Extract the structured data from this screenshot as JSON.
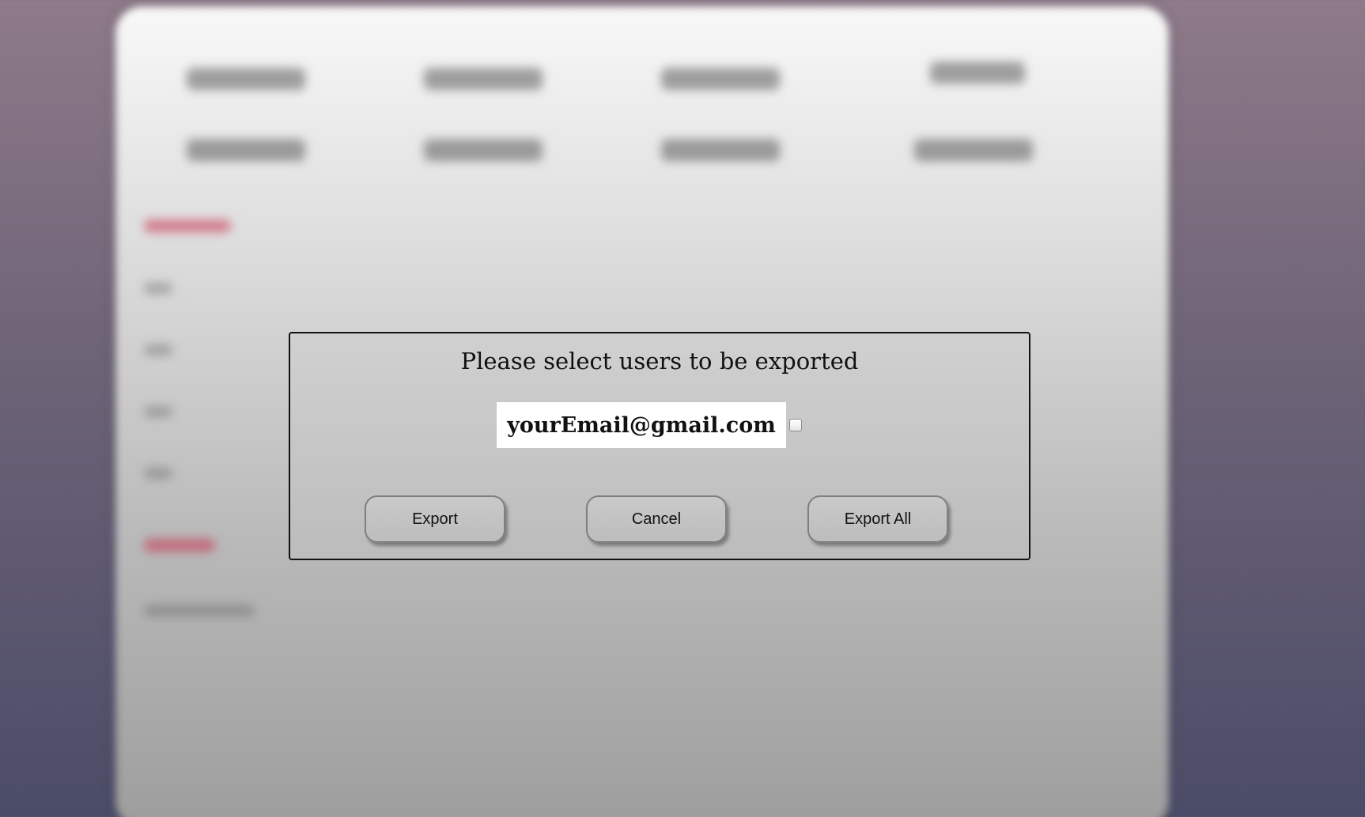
{
  "dialog": {
    "title": "Please select users to be exported",
    "users": [
      {
        "email": "yourEmail@gmail.com",
        "checked": false
      }
    ],
    "buttons": {
      "export": "Export",
      "cancel": "Cancel",
      "export_all": "Export All"
    }
  },
  "colors": {
    "backdrop_top": "#8e7a89",
    "backdrop_bottom": "#4b4c68",
    "accent_blurred": "#c82846"
  }
}
